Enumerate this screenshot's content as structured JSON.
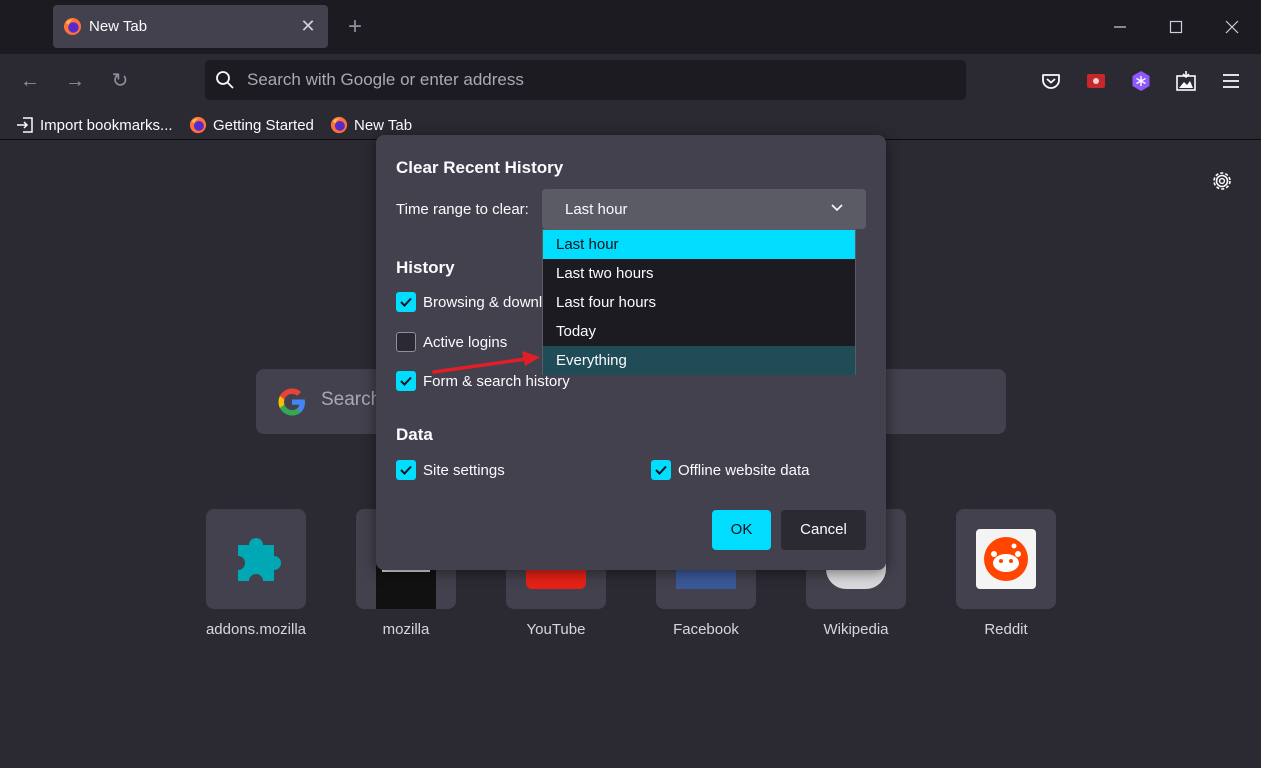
{
  "tab": {
    "title": "New Tab",
    "close": "✕"
  },
  "newtab": "+",
  "window": {
    "minimize": "—",
    "maximize": "☐",
    "close": "✕"
  },
  "nav": {
    "back": "←",
    "forward": "→",
    "reload": "↻"
  },
  "urlbar": {
    "placeholder": "Search with Google or enter address"
  },
  "bookmarks": [
    {
      "label": "Import bookmarks...",
      "icon": "import-icon"
    },
    {
      "label": "Getting Started",
      "icon": "firefox-icon"
    },
    {
      "label": "New Tab",
      "icon": "firefox-icon"
    }
  ],
  "search": {
    "placeholder": "Search"
  },
  "sites": [
    {
      "label": "addons.mozilla"
    },
    {
      "label": "mozilla"
    },
    {
      "label": "YouTube"
    },
    {
      "label": "Facebook"
    },
    {
      "label": "Wikipedia"
    },
    {
      "label": "Reddit"
    }
  ],
  "dialog": {
    "title": "Clear Recent History",
    "time_range_label": "Time range to clear:",
    "selected_range": "Last hour",
    "history_heading": "History",
    "data_heading": "Data",
    "checkboxes": {
      "browsing": {
        "label": "Browsing & downl",
        "checked": true
      },
      "logins": {
        "label": "Active logins",
        "checked": false
      },
      "form": {
        "label": "Form & search history",
        "checked": true
      },
      "site_settings": {
        "label": "Site settings",
        "checked": true
      },
      "offline": {
        "label": "Offline website data",
        "checked": true
      }
    },
    "ok": "OK",
    "cancel": "Cancel"
  },
  "dropdown": {
    "options": [
      "Last hour",
      "Last two hours",
      "Last four hours",
      "Today",
      "Everything"
    ],
    "selected": "Last hour",
    "hovered": "Everything"
  },
  "colors": {
    "accent": "#00ddff",
    "bg": "#2b2a33",
    "dialog": "#42414d",
    "toolbar": "#1c1b22",
    "hover": "#1f4c57",
    "arrow": "#e41e26"
  }
}
